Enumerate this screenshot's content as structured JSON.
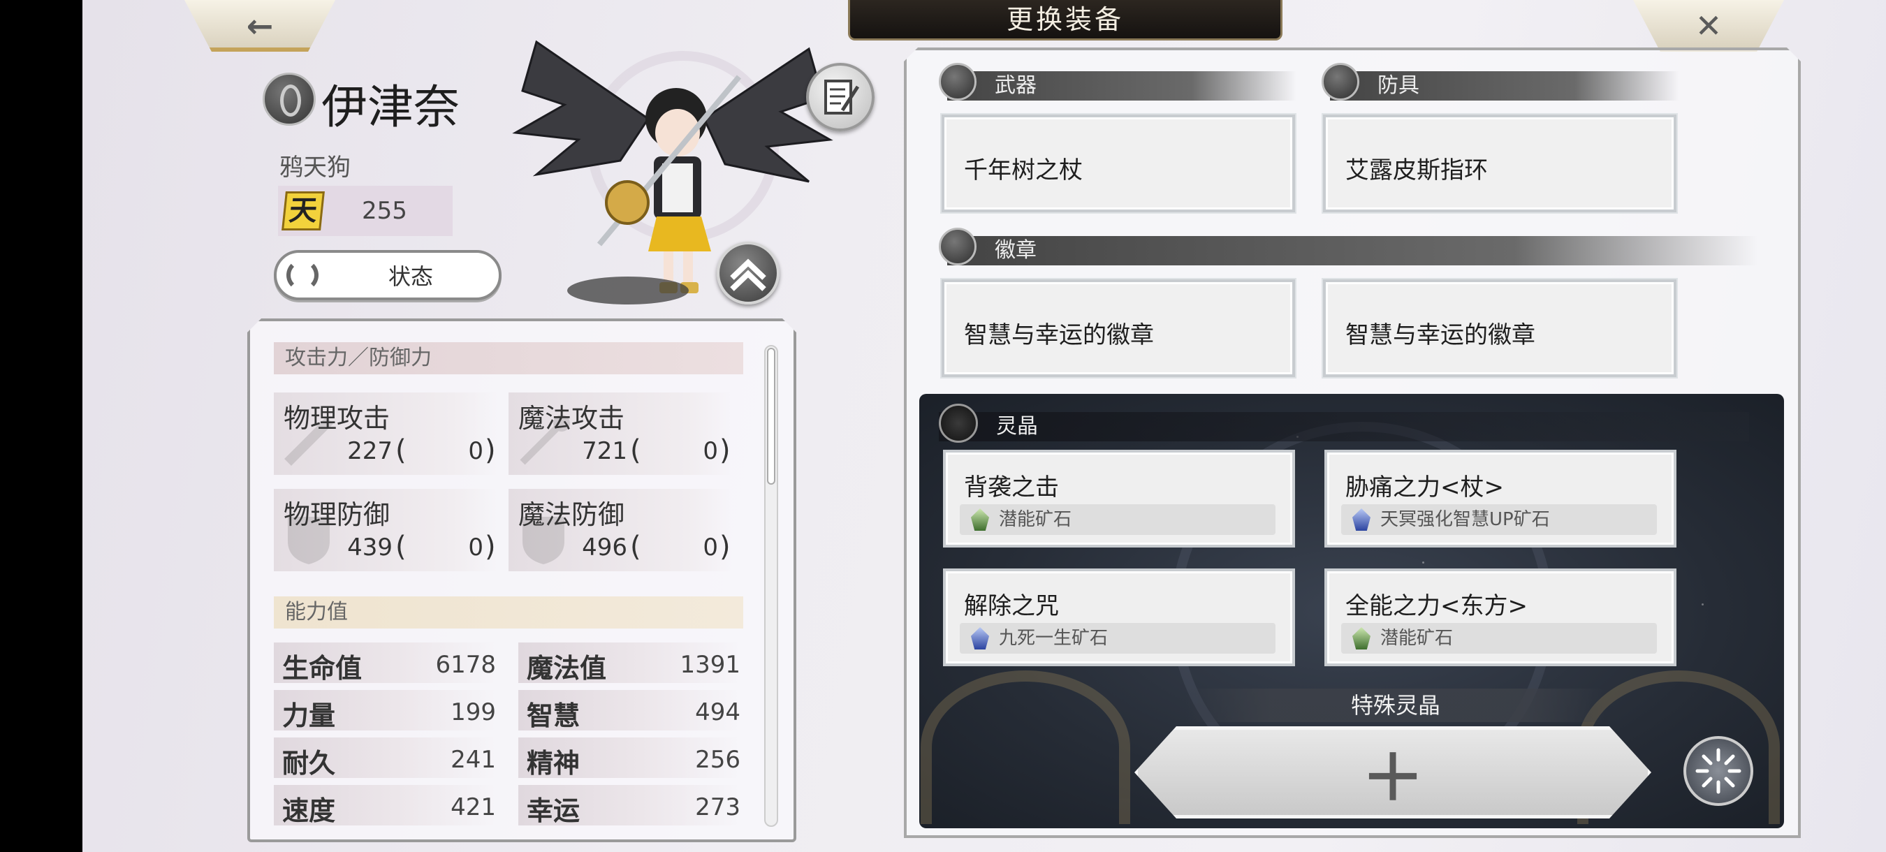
{
  "header": {
    "title": "更换装备",
    "back_icon": "←",
    "close_icon": "✕"
  },
  "character": {
    "name": "伊津奈",
    "title": "鸦天狗",
    "rank_label": "天",
    "rank_value": "255",
    "status_button": "状态"
  },
  "stats": {
    "attack_header": "攻击力／防御力",
    "attack": [
      {
        "label": "物理攻击",
        "value": "227",
        "bonus": "0"
      },
      {
        "label": "魔法攻击",
        "value": "721",
        "bonus": "0"
      },
      {
        "label": "物理防御",
        "value": "439",
        "bonus": "0"
      },
      {
        "label": "魔法防御",
        "value": "496",
        "bonus": "0"
      }
    ],
    "paren_open": "(",
    "paren_close": ")",
    "ability_header": "能力值",
    "abilities": [
      {
        "label": "生命值",
        "value": "6178"
      },
      {
        "label": "魔法值",
        "value": "1391"
      },
      {
        "label": "力量",
        "value": "199"
      },
      {
        "label": "智慧",
        "value": "494"
      },
      {
        "label": "耐久",
        "value": "241"
      },
      {
        "label": "精神",
        "value": "256"
      },
      {
        "label": "速度",
        "value": "421"
      },
      {
        "label": "幸运",
        "value": "273"
      }
    ]
  },
  "equipment": {
    "weapon_header": "武器",
    "armor_header": "防具",
    "badge_header": "徽章",
    "weapon": "千年树之杖",
    "armor": "艾露皮斯指环",
    "badges": [
      "智慧与幸运的徽章",
      "智慧与幸运的徽章"
    ]
  },
  "crystals": {
    "header": "灵晶",
    "slots": [
      {
        "name": "背袭之击",
        "ore": "潜能矿石",
        "ore_color": "green"
      },
      {
        "name": "胁痛之力<杖>",
        "ore": "天冥强化智慧UP矿石",
        "ore_color": "blue"
      },
      {
        "name": "解除之咒",
        "ore": "九死一生矿石",
        "ore_color": "blue"
      },
      {
        "name": "全能之力<东方>",
        "ore": "潜能矿石",
        "ore_color": "green"
      }
    ],
    "special_label": "特殊灵晶",
    "add_icon": "＋"
  },
  "colors": {
    "gold_accent": "#c4a35a",
    "dark_panel": "#262c36",
    "rank_yellow": "#f2d23c"
  }
}
